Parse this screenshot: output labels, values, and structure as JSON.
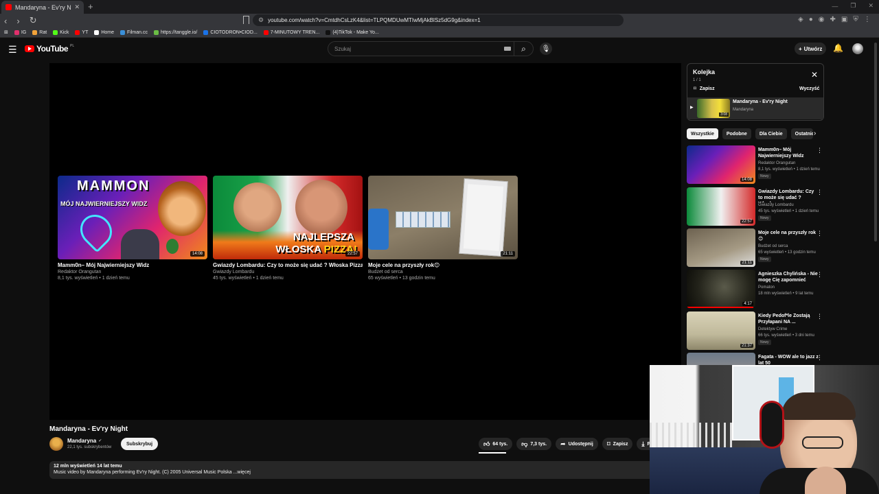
{
  "browser": {
    "tab_title": "Mandaryna - Ev'ry Night - YouTube",
    "url": "youtube.com/watch?v=CmtdhCsLzK4&list=TLPQMDUwMTIwMjAkBlSz5dG9g&index=1",
    "bookmarks": [
      {
        "label": "IG",
        "color": "#e1306c"
      },
      {
        "label": "Rat",
        "color": "#f2a33a"
      },
      {
        "label": "Kick",
        "color": "#53fc18"
      },
      {
        "label": "YT",
        "color": "#ff0000"
      },
      {
        "label": "Home",
        "color": "#ffffff"
      },
      {
        "label": "Filman.cc",
        "color": "#3a8fd8"
      },
      {
        "label": "https://tanggle.io/",
        "color": "#6bbd45"
      },
      {
        "label": "CIOTODRON•CIOD...",
        "color": "#1a73e8"
      },
      {
        "label": "7-MINUTOWY TREN...",
        "color": "#ff0000"
      },
      {
        "label": "(4)TikTok - Make Yo...",
        "color": "#111111"
      }
    ]
  },
  "header": {
    "logo_text": "YouTube",
    "logo_country": "PL",
    "search_placeholder": "Szukaj",
    "create_label": "Utwórz"
  },
  "endscreen": [
    {
      "title": "Mamm0n– Mój Najwierniejszy Widz",
      "channel": "Redaktor Orangutan",
      "meta": "8,1 tys. wyświetleń • 1 dzień temu",
      "duration": "14:08",
      "thumb_title": "MAMMON",
      "thumb_sub": "MÓJ NAJWIERNIEJSZY WIDZ"
    },
    {
      "title": "Gwiazdy Lombardu: Czy to może się udać ? Włoska Pizza",
      "channel": "Gwiazdy Lombardu",
      "meta": "45 tys. wyświetleń • 1 dzień temu",
      "duration": "22:57",
      "thumb_line1": "NAJLEPSZA",
      "thumb_line2a": "WŁOSKA ",
      "thumb_line2b": "PIZZA!"
    },
    {
      "title": "Moje cele na przyszły rok😊",
      "channel": "Budżet od serca",
      "meta": "65 wyświetleń • 13 godzin temu",
      "duration": "21:11"
    }
  ],
  "video": {
    "title": "Mandaryna - Ev'ry Night",
    "channel": "Mandaryna",
    "subscribers": "22,1 tys. subskrybentów",
    "subscribe_label": "Subskrybuj",
    "likes": "64 tys.",
    "dislikes": "7,3 tys.",
    "share_label": "Udostępnij",
    "save_label": "Zapisz",
    "download_label": "Po",
    "views_line": "12 mln wyświetleń  14 lat temu",
    "description": "Music video by Mandaryna performing Ev'ry Night. (C) 2005 Universal Music Polska ...więcej"
  },
  "queue": {
    "title": "Kolejka",
    "count": "1 / 1",
    "save_label": "Zapisz",
    "clear_label": "Wyczyść",
    "item": {
      "title": "Mandaryna - Ev'ry Night",
      "channel": "Mandaryna",
      "duration": "3:08"
    }
  },
  "chips": [
    "Wszystkie",
    "Podobne",
    "Dla Ciebie",
    "Ostatnio"
  ],
  "recommendations": [
    {
      "title": "Mamm0n– Mój Najwierniejszy Widz",
      "channel": "Redaktor Orangutan",
      "meta": "8,1 tys. wyświetleń • 1 dzień temu",
      "badge": "Nowy",
      "duration": "14:08"
    },
    {
      "title": "Gwiazdy Lombardu: Czy to może się udać ? Włoska ...",
      "channel": "Gwiazdy Lombardu",
      "meta": "45 tys. wyświetleń • 1 dzień temu",
      "badge": "Nowy",
      "duration": "22:57"
    },
    {
      "title": "Moje cele na przyszły rok 😊",
      "channel": "Budżet od serca",
      "meta": "65 wyświetleń • 13 godzin temu",
      "badge": "Nowy",
      "duration": "21:11"
    },
    {
      "title": "Agnieszka Chylińska - Nie mogę Cię zapomnieć",
      "channel": "Pomaton",
      "meta": "18 mln wyświetleń • 9 lat temu",
      "badge": "",
      "duration": "4:17",
      "watched": 0.97
    },
    {
      "title": "Kiedy Pedof*le Zostają Przyłapani NA ...",
      "channel": "Detektyw Crime",
      "meta": "66 tys. wyświetleń • 3 dni temu",
      "badge": "Nowy",
      "duration": "21:37"
    },
    {
      "title": "Fagata - WOW ale to jazz z lat 50",
      "channel": "",
      "meta": "",
      "badge": "",
      "duration": ""
    }
  ]
}
